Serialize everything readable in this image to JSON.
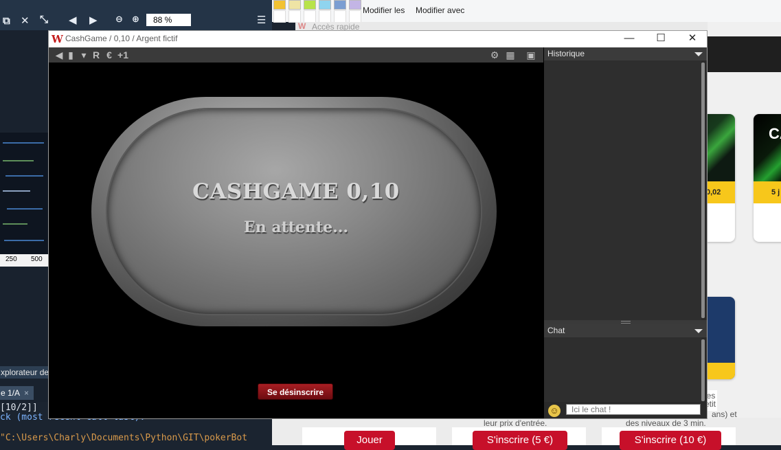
{
  "background": {
    "editor": {
      "zoom": "88 %",
      "thumb_axis": [
        "250",
        "500"
      ],
      "tab_explorer": "xplorateur de v",
      "tab_active": "e 1/A",
      "tab_close": "×",
      "console_lines": [
        "[10/2]]",
        "ck (most recent call last):",
        "\"C:\\Users\\Charly\\Documents\\Python\\GIT\\pokerBot"
      ]
    },
    "paint": {
      "modifier_couleurs": "Modifier les",
      "modifier_paint3d": "Modifier avec",
      "colors": [
        "#f2c232",
        "#efe4a5",
        "#b8e34b",
        "#8fd4ef",
        "#7b9ed2",
        "#c3b5e5"
      ]
    },
    "acces_rapide": "Accès rapide",
    "website": {
      "card1_badge": "0,02",
      "card2_badge": "5 j",
      "card2_title": "CA",
      "text_lines": [
        "leur prix d'entrée.",
        "ans) et",
        "des niveaux de 3 min.",
        "les",
        "etit"
      ],
      "btn_jouer": "Jouer",
      "btn_inscrire_5": "S'inscrire (5 €)",
      "btn_inscrire_10": "S'inscrire (10 €)"
    }
  },
  "window": {
    "title": "CashGame / 0,10 / Argent fictif",
    "controls": {
      "minimize": "—",
      "maximize": "☐",
      "close": "✕"
    }
  },
  "toolbar": {
    "left_icons": [
      "megaphone-icon",
      "stats-icon",
      "mask-icon",
      "replay-icon",
      "cashier-icon",
      "plus-one-icon"
    ],
    "replay_label": "R",
    "plus_label": "+1",
    "right_icons": [
      "settings-icon",
      "layout-icon",
      "window-icon"
    ]
  },
  "table": {
    "title": "CASHGAME 0,10",
    "status": "En attente...",
    "unregister_label": "Se désinscrire"
  },
  "side": {
    "history_label": "Historique",
    "chat_label": "Chat",
    "chat_placeholder": "Ici le chat !"
  }
}
